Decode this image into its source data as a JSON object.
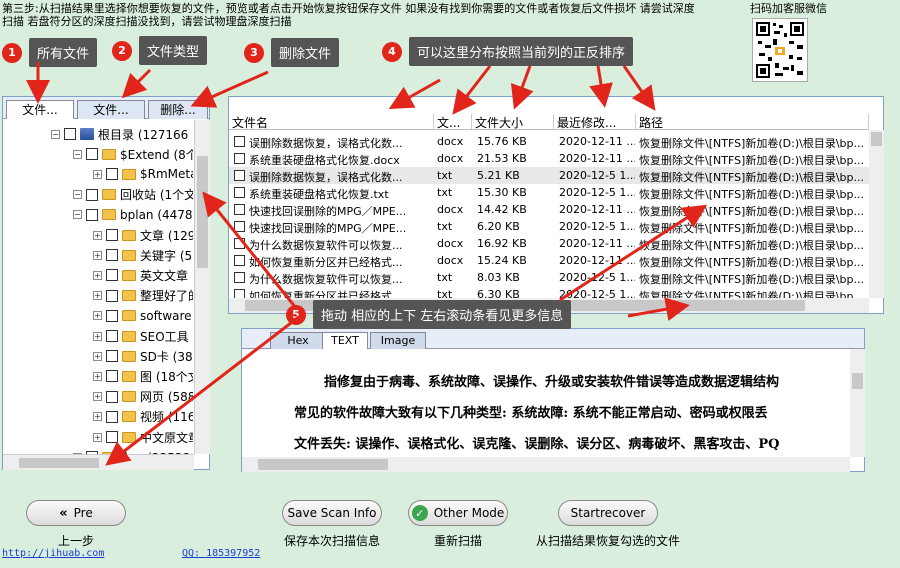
{
  "instructions": "第三步:从扫描结果里选择你想要恢复的文件，预览或者点击开始恢复按钮保存文件 如果没有找到你需要的文件或者恢复后文件损坏 请尝试深度扫描 若盘符分区的深度扫描没找到，请尝试物理盘深度扫描",
  "qr_label": "扫码加客服微信",
  "callouts": [
    {
      "num": "1",
      "text": "所有文件"
    },
    {
      "num": "2",
      "text": "文件类型"
    },
    {
      "num": "3",
      "text": "删除文件"
    },
    {
      "num": "4",
      "text": "可以这里分布按照当前列的正反排序"
    },
    {
      "num": "5",
      "text": "拖动 相应的上下 左右滚动条看见更多信息"
    }
  ],
  "left_tabs": [
    "文件...",
    "文件...",
    "删除..."
  ],
  "tree": [
    {
      "label": "根目录 (127166",
      "level": 0,
      "type": "drive"
    },
    {
      "label": "$Extend (8个",
      "level": 1,
      "type": "folder"
    },
    {
      "label": "$RmMeta",
      "level": 2,
      "type": "folder"
    },
    {
      "label": "回收站 (1个文",
      "level": 1,
      "type": "folder"
    },
    {
      "label": "bplan (4478",
      "level": 1,
      "type": "folder"
    },
    {
      "label": "文章 (129",
      "level": 2,
      "type": "folder"
    },
    {
      "label": "关键字 (5",
      "level": 2,
      "type": "folder"
    },
    {
      "label": "英文文章",
      "level": 2,
      "type": "folder"
    },
    {
      "label": "整理好了的",
      "level": 2,
      "type": "folder"
    },
    {
      "label": "software",
      "level": 2,
      "type": "folder"
    },
    {
      "label": "SEO工具",
      "level": 2,
      "type": "folder"
    },
    {
      "label": "SD卡 (38",
      "level": 2,
      "type": "folder"
    },
    {
      "label": "图 (18个文",
      "level": 2,
      "type": "folder"
    },
    {
      "label": "网页 (588",
      "level": 2,
      "type": "folder"
    },
    {
      "label": "视频 (116",
      "level": 2,
      "type": "folder"
    },
    {
      "label": "中文原文章",
      "level": 2,
      "type": "folder"
    },
    {
      "label": "文... (23528",
      "level": 1,
      "type": "folder"
    }
  ],
  "columns": [
    "文件名",
    "文...",
    "文件大小",
    "最近修改...",
    "路径"
  ],
  "files": [
    {
      "name": "误删除数据恢复，误格式化数...",
      "type": "docx",
      "size": "15.76 KB",
      "date": "2020-12-11 ...",
      "path": "恢复删除文件\\[NTFS]新加卷(D:)\\根目录\\bp..."
    },
    {
      "name": "系统重装硬盘格式化恢复.docx",
      "type": "docx",
      "size": "21.53 KB",
      "date": "2020-12-11 ...",
      "path": "恢复删除文件\\[NTFS]新加卷(D:)\\根目录\\bp..."
    },
    {
      "name": "误删除数据恢复，误格式化数...",
      "type": "txt",
      "size": "5.21 KB",
      "date": "2020-12-5 1...",
      "path": "恢复删除文件\\[NTFS]新加卷(D:)\\根目录\\bp..."
    },
    {
      "name": "系统重装硬盘格式化恢复.txt",
      "type": "txt",
      "size": "15.30 KB",
      "date": "2020-12-5 1...",
      "path": "恢复删除文件\\[NTFS]新加卷(D:)\\根目录\\bp..."
    },
    {
      "name": "快速找回误删除的MPG／MPE...",
      "type": "docx",
      "size": "14.42 KB",
      "date": "2020-12-11 ...",
      "path": "恢复删除文件\\[NTFS]新加卷(D:)\\根目录\\bp..."
    },
    {
      "name": "快速找回误删除的MPG／MPE...",
      "type": "txt",
      "size": "6.20 KB",
      "date": "2020-12-5 1...",
      "path": "恢复删除文件\\[NTFS]新加卷(D:)\\根目录\\bp..."
    },
    {
      "name": "为什么数据恢复软件可以恢复...",
      "type": "docx",
      "size": "16.92 KB",
      "date": "2020-12-11 ...",
      "path": "恢复删除文件\\[NTFS]新加卷(D:)\\根目录\\bp..."
    },
    {
      "name": "如何恢复重新分区并已经格式...",
      "type": "docx",
      "size": "15.24 KB",
      "date": "2020-12-11 ...",
      "path": "恢复删除文件\\[NTFS]新加卷(D:)\\根目录\\bp..."
    },
    {
      "name": "为什么数据恢复软件可以恢复...",
      "type": "txt",
      "size": "8.03 KB",
      "date": "2020-12-5 1...",
      "path": "恢复删除文件\\[NTFS]新加卷(D:)\\根目录\\bp..."
    },
    {
      "name": "如何恢复重新分区并已经格式...",
      "type": "txt",
      "size": "6.30 KB",
      "date": "2020-12-5 1...",
      "path": "恢复删除文件\\[NTFS]新加卷(D:)\\根目录\\bp..."
    }
  ],
  "preview_tabs": [
    "Hex",
    "TEXT",
    "Image"
  ],
  "preview_lines": [
    "指修复由于病毒、系统故障、误操作、升级或安装软件错误等造成数据逻辑结构",
    "常见的软件故障大致有以下几种类型: 系统故障: 系统不能正常启动、密码或权限丢",
    "文件丢失: 误操作、误格式化、误克隆、误删除、误分区、病毒破坏、黑客攻击、PQ"
  ],
  "buttons": {
    "pre": "Pre",
    "pre_caption": "上一步",
    "save_scan": "Save Scan Info",
    "save_scan_caption": "保存本次扫描信息",
    "other_mode": "Other Mode",
    "other_mode_caption": "重新扫描",
    "startrecover": "Startrecover",
    "startrecover_caption": "从扫描结果恢复勾选的文件"
  },
  "footer": {
    "url": "http://jihuab.com",
    "qq": "QQ: 185397952"
  },
  "colors": {
    "badge": "#e1251b",
    "callout_bg": "#555555",
    "arrow": "#e1251b",
    "link": "#1a3fd0"
  }
}
